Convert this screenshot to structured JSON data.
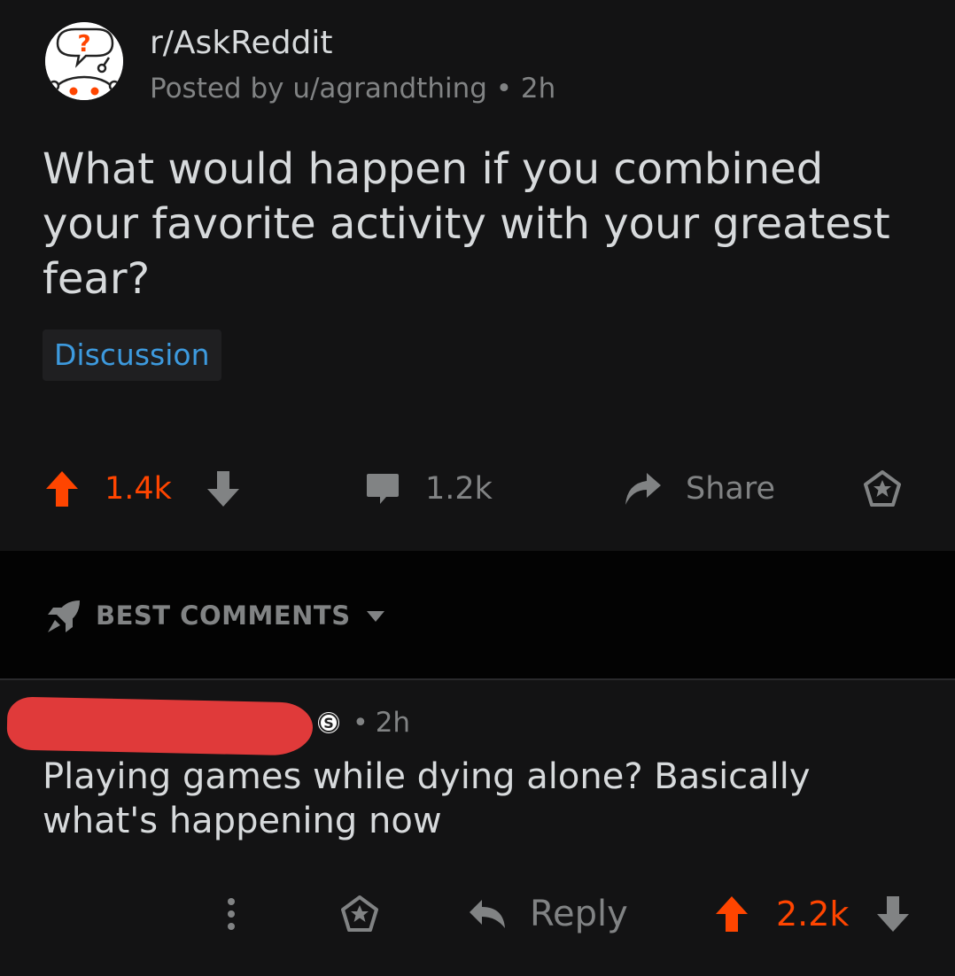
{
  "post": {
    "subreddit": "r/AskReddit",
    "posted_by": "Posted by u/agrandthing • 2h",
    "title": "What would happen if you combined your favorite activity with your greatest fear?",
    "flair": "Discussion",
    "upvotes": "1.4k",
    "comments": "1.2k",
    "share_label": "Share"
  },
  "sort": {
    "label": "BEST COMMENTS"
  },
  "comment": {
    "dot": "•",
    "time": "2h",
    "body": "Playing games while dying alone? Basically what's happening now",
    "reply_label": "Reply",
    "upvotes": "2.2k"
  },
  "colors": {
    "upvote_orange": "#ff4500",
    "flair_blue": "#3d9ade",
    "text_grey": "#818384",
    "redaction_red": "#e03a3a"
  }
}
